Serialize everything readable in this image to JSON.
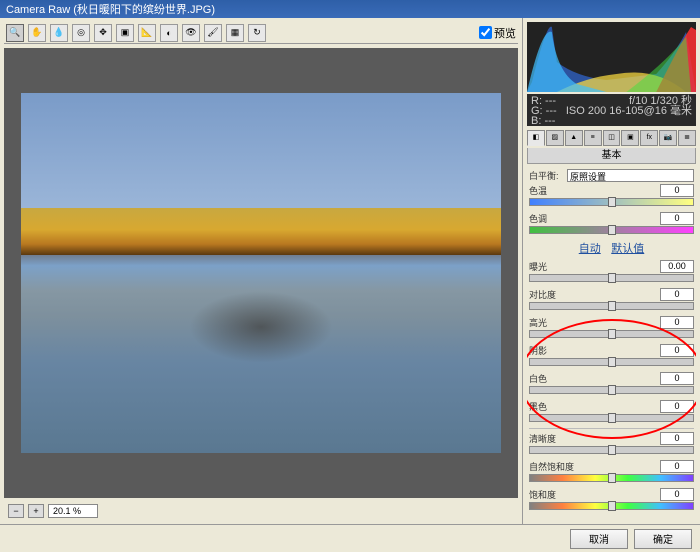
{
  "title": "Camera Raw (秋日暖阳下的缤纷世界.JPG)",
  "preview_label": "预览",
  "zoom": {
    "value": "20.1 %"
  },
  "info": {
    "r": "R:  ---",
    "g": "G:  ---",
    "b": "B:  ---",
    "exp1": "f/10  1/320 秒",
    "exp2": "ISO 200  16-105@16 毫米"
  },
  "panel": {
    "title": "基本",
    "wb_label": "白平衡:",
    "wb_value": "原照设置",
    "sliders": {
      "temp": {
        "label": "色温",
        "value": "0"
      },
      "tint": {
        "label": "色调",
        "value": "0"
      },
      "exp": {
        "label": "曝光",
        "value": "0.00"
      },
      "contr": {
        "label": "对比度",
        "value": "0"
      },
      "high": {
        "label": "高光",
        "value": "0"
      },
      "shad": {
        "label": "阴影",
        "value": "0"
      },
      "white": {
        "label": "白色",
        "value": "0"
      },
      "black": {
        "label": "黑色",
        "value": "0"
      },
      "clar": {
        "label": "清晰度",
        "value": "0"
      },
      "vib": {
        "label": "自然饱和度",
        "value": "0"
      },
      "sat": {
        "label": "饱和度",
        "value": "0"
      }
    },
    "auto": "自动",
    "default": "默认值"
  },
  "buttons": {
    "cancel": "取消",
    "ok": "确定"
  }
}
